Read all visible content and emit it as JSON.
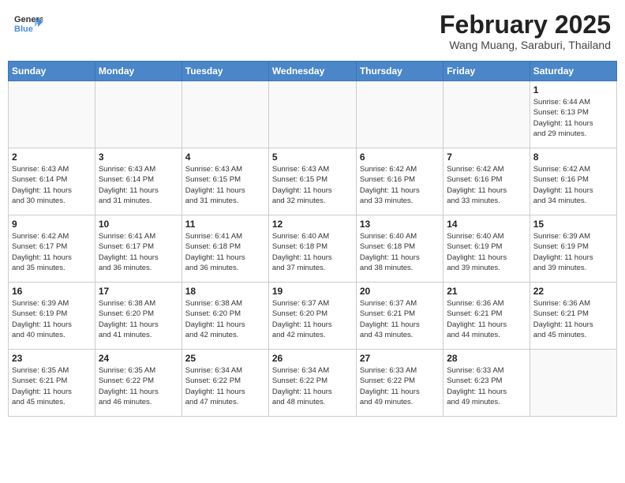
{
  "header": {
    "logo_general": "General",
    "logo_blue": "Blue",
    "month_title": "February 2025",
    "location": "Wang Muang, Saraburi, Thailand"
  },
  "weekdays": [
    "Sunday",
    "Monday",
    "Tuesday",
    "Wednesday",
    "Thursday",
    "Friday",
    "Saturday"
  ],
  "weeks": [
    [
      {
        "day": "",
        "info": ""
      },
      {
        "day": "",
        "info": ""
      },
      {
        "day": "",
        "info": ""
      },
      {
        "day": "",
        "info": ""
      },
      {
        "day": "",
        "info": ""
      },
      {
        "day": "",
        "info": ""
      },
      {
        "day": "1",
        "info": "Sunrise: 6:44 AM\nSunset: 6:13 PM\nDaylight: 11 hours\nand 29 minutes."
      }
    ],
    [
      {
        "day": "2",
        "info": "Sunrise: 6:43 AM\nSunset: 6:14 PM\nDaylight: 11 hours\nand 30 minutes."
      },
      {
        "day": "3",
        "info": "Sunrise: 6:43 AM\nSunset: 6:14 PM\nDaylight: 11 hours\nand 31 minutes."
      },
      {
        "day": "4",
        "info": "Sunrise: 6:43 AM\nSunset: 6:15 PM\nDaylight: 11 hours\nand 31 minutes."
      },
      {
        "day": "5",
        "info": "Sunrise: 6:43 AM\nSunset: 6:15 PM\nDaylight: 11 hours\nand 32 minutes."
      },
      {
        "day": "6",
        "info": "Sunrise: 6:42 AM\nSunset: 6:16 PM\nDaylight: 11 hours\nand 33 minutes."
      },
      {
        "day": "7",
        "info": "Sunrise: 6:42 AM\nSunset: 6:16 PM\nDaylight: 11 hours\nand 33 minutes."
      },
      {
        "day": "8",
        "info": "Sunrise: 6:42 AM\nSunset: 6:16 PM\nDaylight: 11 hours\nand 34 minutes."
      }
    ],
    [
      {
        "day": "9",
        "info": "Sunrise: 6:42 AM\nSunset: 6:17 PM\nDaylight: 11 hours\nand 35 minutes."
      },
      {
        "day": "10",
        "info": "Sunrise: 6:41 AM\nSunset: 6:17 PM\nDaylight: 11 hours\nand 36 minutes."
      },
      {
        "day": "11",
        "info": "Sunrise: 6:41 AM\nSunset: 6:18 PM\nDaylight: 11 hours\nand 36 minutes."
      },
      {
        "day": "12",
        "info": "Sunrise: 6:40 AM\nSunset: 6:18 PM\nDaylight: 11 hours\nand 37 minutes."
      },
      {
        "day": "13",
        "info": "Sunrise: 6:40 AM\nSunset: 6:18 PM\nDaylight: 11 hours\nand 38 minutes."
      },
      {
        "day": "14",
        "info": "Sunrise: 6:40 AM\nSunset: 6:19 PM\nDaylight: 11 hours\nand 39 minutes."
      },
      {
        "day": "15",
        "info": "Sunrise: 6:39 AM\nSunset: 6:19 PM\nDaylight: 11 hours\nand 39 minutes."
      }
    ],
    [
      {
        "day": "16",
        "info": "Sunrise: 6:39 AM\nSunset: 6:19 PM\nDaylight: 11 hours\nand 40 minutes."
      },
      {
        "day": "17",
        "info": "Sunrise: 6:38 AM\nSunset: 6:20 PM\nDaylight: 11 hours\nand 41 minutes."
      },
      {
        "day": "18",
        "info": "Sunrise: 6:38 AM\nSunset: 6:20 PM\nDaylight: 11 hours\nand 42 minutes."
      },
      {
        "day": "19",
        "info": "Sunrise: 6:37 AM\nSunset: 6:20 PM\nDaylight: 11 hours\nand 42 minutes."
      },
      {
        "day": "20",
        "info": "Sunrise: 6:37 AM\nSunset: 6:21 PM\nDaylight: 11 hours\nand 43 minutes."
      },
      {
        "day": "21",
        "info": "Sunrise: 6:36 AM\nSunset: 6:21 PM\nDaylight: 11 hours\nand 44 minutes."
      },
      {
        "day": "22",
        "info": "Sunrise: 6:36 AM\nSunset: 6:21 PM\nDaylight: 11 hours\nand 45 minutes."
      }
    ],
    [
      {
        "day": "23",
        "info": "Sunrise: 6:35 AM\nSunset: 6:21 PM\nDaylight: 11 hours\nand 45 minutes."
      },
      {
        "day": "24",
        "info": "Sunrise: 6:35 AM\nSunset: 6:22 PM\nDaylight: 11 hours\nand 46 minutes."
      },
      {
        "day": "25",
        "info": "Sunrise: 6:34 AM\nSunset: 6:22 PM\nDaylight: 11 hours\nand 47 minutes."
      },
      {
        "day": "26",
        "info": "Sunrise: 6:34 AM\nSunset: 6:22 PM\nDaylight: 11 hours\nand 48 minutes."
      },
      {
        "day": "27",
        "info": "Sunrise: 6:33 AM\nSunset: 6:22 PM\nDaylight: 11 hours\nand 49 minutes."
      },
      {
        "day": "28",
        "info": "Sunrise: 6:33 AM\nSunset: 6:23 PM\nDaylight: 11 hours\nand 49 minutes."
      },
      {
        "day": "",
        "info": ""
      }
    ]
  ]
}
